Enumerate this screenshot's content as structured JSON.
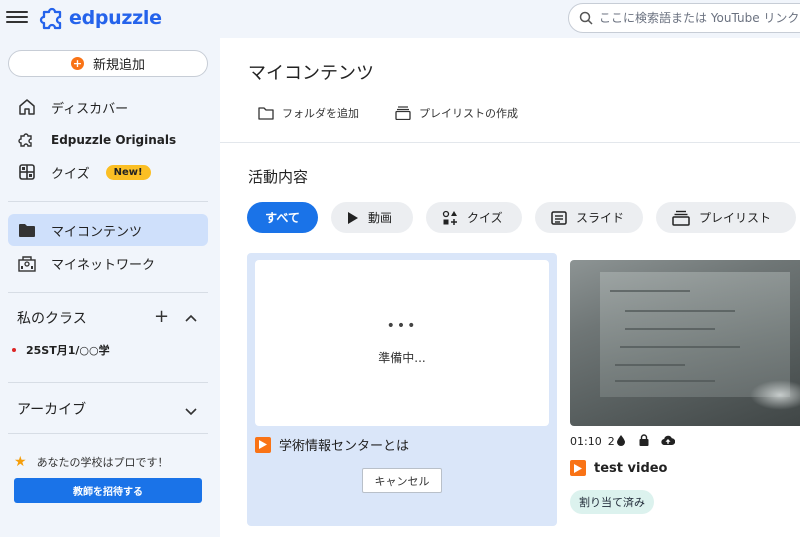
{
  "header": {
    "logo_text": "edpuzzle",
    "search_placeholder": "ここに検索語または YouTube リンク"
  },
  "sidebar": {
    "add_label": "新規追加",
    "nav": [
      {
        "label": "ディスカバー",
        "icon": "home-icon"
      },
      {
        "label": "Edpuzzle Originals",
        "icon": "puzzle-icon"
      },
      {
        "label": "クイズ",
        "icon": "grid-icon",
        "badge": "New!"
      },
      {
        "label": "マイコンテンツ",
        "icon": "folder-icon",
        "active": true
      },
      {
        "label": "マイネットワーク",
        "icon": "school-icon"
      }
    ],
    "classes_title": "私のクラス",
    "class_items": [
      {
        "label": "25ST月1/○○学"
      }
    ],
    "archive_title": "アーカイブ",
    "promo_text": "あなたの学校はプロです！",
    "invite_label": "教師を招待する"
  },
  "main": {
    "title": "マイコンテンツ",
    "actions": [
      {
        "label": "フォルダを追加",
        "icon": "folder-outline-icon"
      },
      {
        "label": "プレイリストの作成",
        "icon": "playlist-icon"
      }
    ],
    "activity_title": "活動内容",
    "filters": [
      {
        "label": "すべて",
        "active": true
      },
      {
        "label": "動画",
        "icon": "play-icon"
      },
      {
        "label": "クイズ",
        "icon": "quiz-shapes-icon"
      },
      {
        "label": "スライド",
        "icon": "slides-icon"
      },
      {
        "label": "プレイリスト",
        "icon": "playlist-icon"
      }
    ],
    "cards": [
      {
        "status_dots": "•••",
        "status": "準備中...",
        "title": "学術情報センターとは",
        "cancel_label": "キャンセル"
      },
      {
        "duration": "01:10",
        "questions": "2",
        "title": "test video",
        "badge": "割り当て済み"
      }
    ]
  },
  "colors": {
    "accent": "#1a73e8",
    "brand": "#2563eb",
    "orange": "#f97316",
    "sidebar_bg": "#f1f5fb",
    "active_bg": "#cfe0fb"
  }
}
